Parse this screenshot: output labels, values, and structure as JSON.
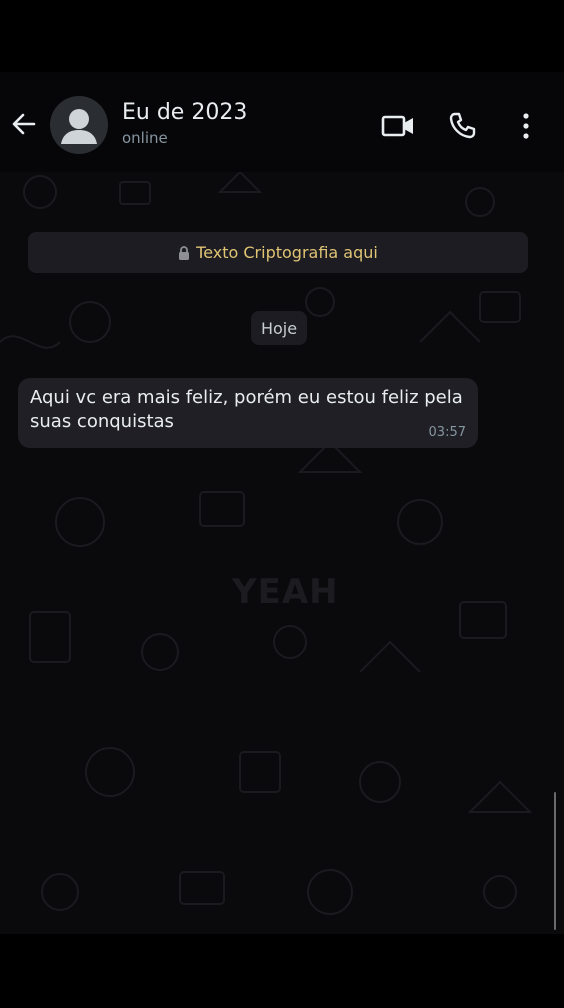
{
  "header": {
    "contact_name": "Eu de 2023",
    "status": "online"
  },
  "chat": {
    "encryption_notice": "Texto Criptografia aqui",
    "date_label": "Hoje",
    "messages": [
      {
        "text": "Aqui vc era mais feliz, porém eu estou feliz pela suas conquistas",
        "time": "03:57"
      }
    ],
    "watermark": "YEAH"
  },
  "colors": {
    "header_bg": "#060608",
    "chat_bg": "#0a0a0c",
    "bubble_bg": "#1f1f25",
    "encryption_text": "#e0c474"
  },
  "icons": {
    "back": "arrow-left-icon",
    "avatar": "default-avatar-icon",
    "video": "video-camera-icon",
    "call": "phone-icon",
    "menu": "more-vertical-icon",
    "lock": "lock-icon"
  }
}
